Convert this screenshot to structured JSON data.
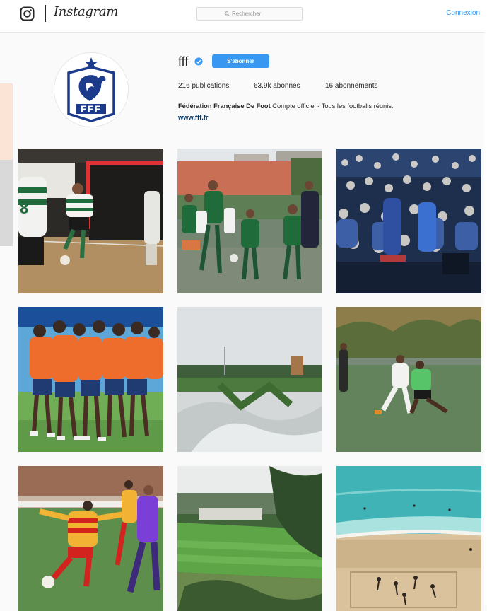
{
  "header": {
    "brand": "Instagram",
    "search_placeholder": "Rechercher",
    "login_label": "Connexion"
  },
  "profile": {
    "username": "fff",
    "verified": true,
    "follow_label": "S'abonner",
    "stats": {
      "posts_count": "216",
      "posts_label": "publications",
      "followers_count": "63,9k",
      "followers_label": "abonnés",
      "following_count": "16",
      "following_label": "abonnements"
    },
    "full_name": "Fédération Française De Foot",
    "bio": "Compte officiel - Tous les footballs réunis.",
    "website": "www.fff.fr",
    "avatar_text": "FFF"
  },
  "posts": [
    {
      "subject": "futsal-match-green-white-kit"
    },
    {
      "subject": "kids-football-training-green-kit"
    },
    {
      "subject": "stadium-crowd-supporters"
    },
    {
      "subject": "players-huddle-orange-bibs"
    },
    {
      "subject": "artificial-turf-close-up"
    },
    {
      "subject": "amateur-match-white-vs-green"
    },
    {
      "subject": "womens-match-orange-vs-purple"
    },
    {
      "subject": "green-pitch-among-trees"
    },
    {
      "subject": "beach-football-aerial"
    }
  ],
  "colors": {
    "accent": "#3897f0",
    "link_dark": "#003569",
    "fff_blue": "#1d3b8b"
  }
}
